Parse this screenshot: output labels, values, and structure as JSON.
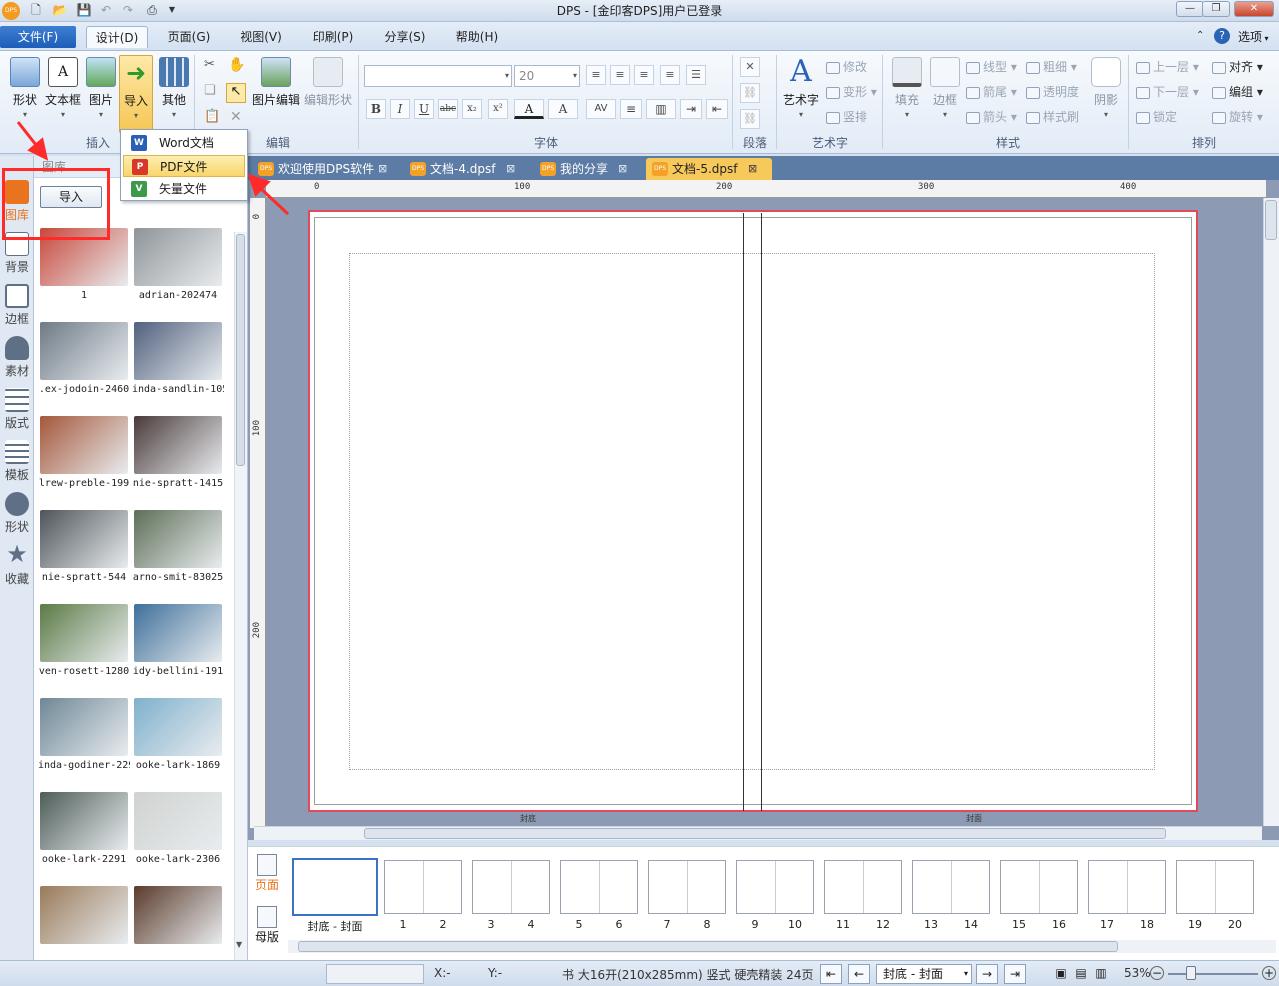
{
  "window": {
    "title": "DPS - [金印客DPS]用户已登录",
    "app_icon": "DPS"
  },
  "menu": {
    "file": "文件(F)",
    "tabs": [
      "设计(D)",
      "页面(G)",
      "视图(V)",
      "印刷(P)",
      "分享(S)",
      "帮助(H)"
    ],
    "options": "选项"
  },
  "ribbon": {
    "insert": {
      "label": "插入",
      "buttons": [
        "形状",
        "文本框",
        "图片",
        "导入",
        "其他"
      ]
    },
    "edit": {
      "label": "编辑",
      "image_edit": "图片编辑",
      "edit_shape": "编辑形状"
    },
    "font": {
      "label": "字体",
      "size": "20"
    },
    "paragraph": {
      "label": "段落"
    },
    "art": {
      "label": "艺术字",
      "button": "艺术字",
      "modify": "修改",
      "transform": "变形",
      "vertical": "竖排"
    },
    "style": {
      "label": "样式",
      "fill": "填充",
      "border": "边框",
      "line_type": "线型",
      "line_end": "箭尾",
      "arrow_head": "箭头",
      "thickness": "粗细",
      "transparency": "透明度",
      "style_brush": "样式刷",
      "shadow": "阴影"
    },
    "arrange": {
      "label": "排列",
      "up": "上一层",
      "down": "下一层",
      "lock": "锁定",
      "align": "对齐",
      "group": "编组",
      "rotate": "旋转"
    }
  },
  "import_menu": {
    "items": [
      "Word文档",
      "PDF文件",
      "矢量文件"
    ]
  },
  "doc_tabs": [
    {
      "label": "欢迎使用DPS软件"
    },
    {
      "label": "文档-4.dpsf"
    },
    {
      "label": "我的分享"
    },
    {
      "label": "文档-5.dpsf"
    }
  ],
  "left_rail": [
    "图库",
    "背景",
    "边框",
    "素材",
    "版式",
    "模板",
    "形状",
    "收藏"
  ],
  "gallery": {
    "header": "图库",
    "import_button": "导入",
    "items": [
      {
        "label": "1",
        "color": "#c8473a"
      },
      {
        "label": "adrian-202474",
        "color": "#8f9498"
      },
      {
        "label": ".ex-jodoin-2460",
        "color": "#6e7a86"
      },
      {
        "label": "inda-sandlin-105",
        "color": "#51607e"
      },
      {
        "label": "lrew-preble-199",
        "color": "#a5573a"
      },
      {
        "label": "nie-spratt-1415",
        "color": "#4a3a3a"
      },
      {
        "label": "nie-spratt-544",
        "color": "#4e5459"
      },
      {
        "label": "arno-smit-83025",
        "color": "#5d6f58"
      },
      {
        "label": "ven-rosett-1280",
        "color": "#5b7a45"
      },
      {
        "label": "idy-bellini-191",
        "color": "#3e6f9a"
      },
      {
        "label": "inda-godiner-229",
        "color": "#6f8796"
      },
      {
        "label": "ooke-lark-1869",
        "color": "#7fb0cc"
      },
      {
        "label": "ooke-lark-2291",
        "color": "#4e5d58"
      },
      {
        "label": "ooke-lark-2306",
        "color": "#cfd2cf"
      },
      {
        "label": "",
        "color": "#9a7a5a"
      },
      {
        "label": "",
        "color": "#5a3a2a"
      }
    ]
  },
  "ruler": {
    "h": [
      "0",
      "100",
      "200",
      "300",
      "400"
    ],
    "v": [
      "0",
      "100",
      "200"
    ]
  },
  "page": {
    "left_caption": "封底",
    "right_caption": "封面"
  },
  "pages_panel": {
    "page_label": "页面",
    "master_label": "母版",
    "first_label": "封底 - 封面",
    "numbers": [
      "1",
      "2",
      "3",
      "4",
      "5",
      "6",
      "7",
      "8",
      "9",
      "10",
      "11",
      "12",
      "13",
      "14",
      "15",
      "16",
      "17",
      "18",
      "19",
      "20"
    ]
  },
  "status": {
    "x": "X:-",
    "y": "Y:-",
    "book_info": "书 大16开(210x285mm) 竖式 硬壳精装 24页",
    "current_page": "封底 - 封面",
    "zoom": "53%"
  },
  "colors": {
    "accent": "#1c5db8",
    "annotation": "#ff2a2a",
    "page_border": "#e14a5b",
    "active_tab": "#f7c85a"
  }
}
